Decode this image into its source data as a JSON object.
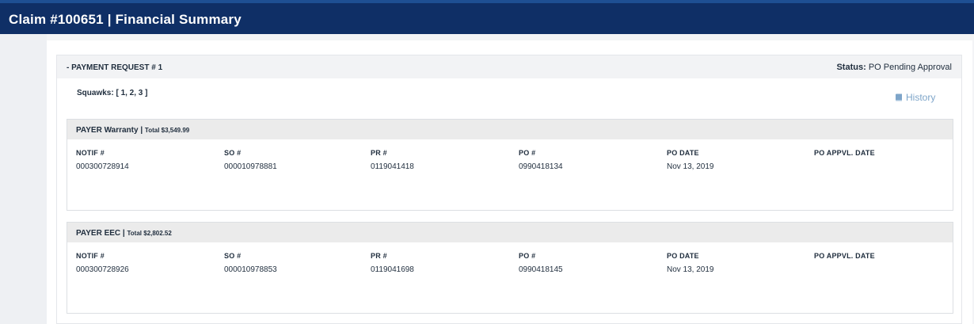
{
  "header": {
    "title": "Claim #100651 | Financial Summary"
  },
  "payment_request": {
    "title": "- PAYMENT REQUEST # 1",
    "status_label": "Status:",
    "status_value": "PO Pending Approval",
    "squawks": "Squawks: [ 1, 2, 3 ]",
    "history_label": "History",
    "history_icon": "book-icon"
  },
  "field_labels": {
    "notif": "NOTIF #",
    "so": "SO #",
    "pr": "PR #",
    "po": "PO #",
    "po_date": "PO DATE",
    "po_appvl_date": "PO APPVL. DATE"
  },
  "payers": [
    {
      "name": "PAYER Warranty | ",
      "total": "Total $3,549.99",
      "notif": "000300728914",
      "so": "000010978881",
      "pr": "0119041418",
      "po": "0990418134",
      "po_date": "Nov 13, 2019",
      "po_appvl_date": ""
    },
    {
      "name": "PAYER EEC | ",
      "total": "Total $2,802.52",
      "notif": "000300728926",
      "so": "000010978853",
      "pr": "0119041698",
      "po": "0990418145",
      "po_date": "Nov 13, 2019",
      "po_appvl_date": ""
    }
  ],
  "colors": {
    "header_bg": "#0f2f66",
    "link": "#7ea5c9",
    "section_bg": "#ebebeb"
  }
}
